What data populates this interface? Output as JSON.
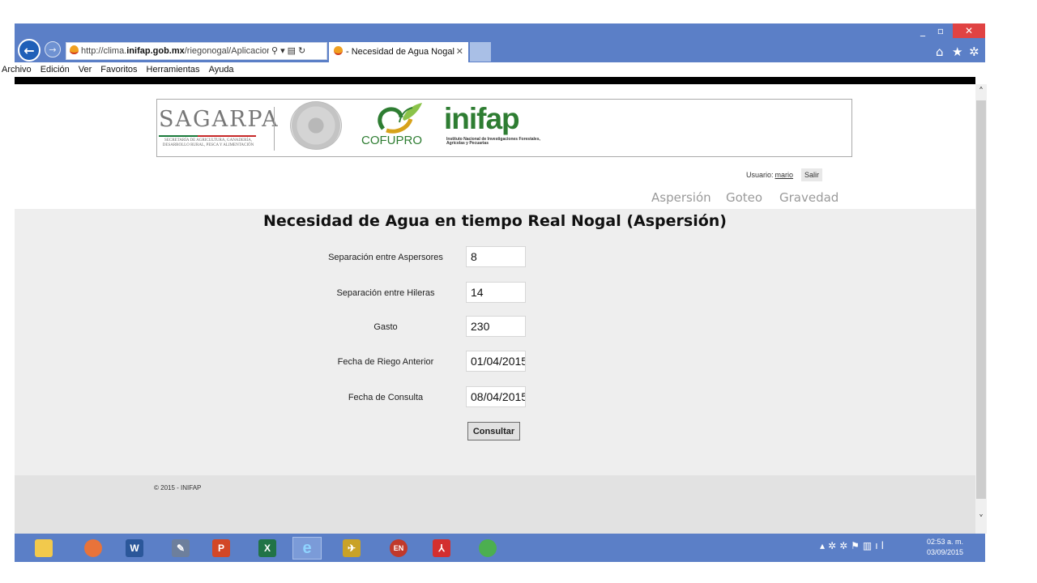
{
  "browser": {
    "address_url_prefix": "http://clima.",
    "address_url_bold": "inifap.gob.mx",
    "address_url_suffix": "/riegonogal/Aplicacion/.",
    "tab_title": "- Necesidad de Agua Nogal",
    "menu": [
      "Archivo",
      "Edición",
      "Ver",
      "Favoritos",
      "Herramientas",
      "Ayuda"
    ]
  },
  "header": {
    "sagarpa_name": "SAGARPA",
    "sagarpa_subtitle": "SECRETARÍA DE AGRICULTURA, GANADERÍA, DESARROLLO RURAL, PESCA Y ALIMENTACIÓN",
    "cofupro_name": "COFUPRO",
    "inifap_name": "inifap",
    "inifap_subtitle": "Instituto Nacional de Investigaciones Forestales, Agrícolas y Pecuarias"
  },
  "user": {
    "label": "Usuario:",
    "name": "mario",
    "logout_label": "Salir"
  },
  "nav": {
    "aspersion": "Aspersión",
    "goteo": "Goteo",
    "gravedad": "Gravedad"
  },
  "form": {
    "title": "Necesidad de Agua en tiempo Real Nogal (Aspersión)",
    "fields": [
      {
        "label": "Separación entre Aspersores",
        "value": "8"
      },
      {
        "label": "Separación entre Hileras",
        "value": "14"
      },
      {
        "label": "Gasto",
        "value": "230"
      },
      {
        "label": "Fecha de Riego Anterior",
        "value": "01/04/2015"
      },
      {
        "label": "Fecha de Consulta",
        "value": "08/04/2015"
      }
    ],
    "submit_label": "Consultar"
  },
  "footer": {
    "text": "© 2015 - INIFAP"
  },
  "taskbar": {
    "clock_time": "02:53 a. m.",
    "clock_date": "03/09/2015"
  },
  "colors": {
    "chrome_blue": "#5b7fc7",
    "inifap_green": "#2e7d32",
    "close_red": "#e04343"
  }
}
